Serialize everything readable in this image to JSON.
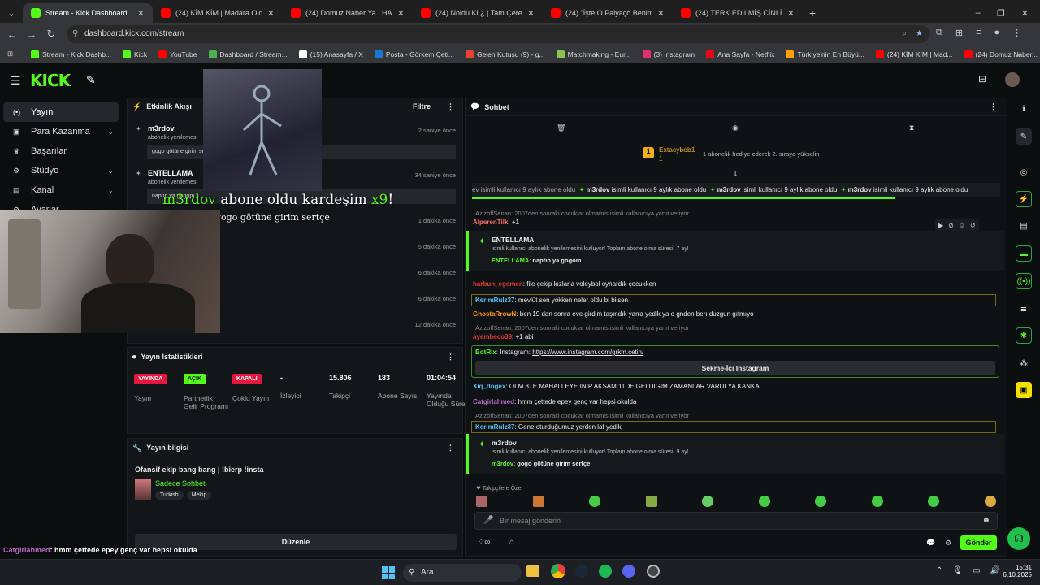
{
  "tabs": [
    {
      "title": "Stream - Kick Dashboard",
      "color": "#53fc18",
      "active": true
    },
    {
      "title": "(24) KİM KİM | Madara Olduk #",
      "color": "#ff0000"
    },
    {
      "title": "(24) Domuz Naber Ya | HAFTAL",
      "color": "#ff0000"
    },
    {
      "title": "(24) Noldu Ki ¿ | Tam Çerezlik | -",
      "color": "#ff0000"
    },
    {
      "title": "(24) \"İşte O Palyaço Benim\" Kic",
      "color": "#ff0000"
    },
    {
      "title": "(24) TERK EDİLMİŞ CİNLİ KÖYDE",
      "color": "#ff0000"
    }
  ],
  "url": "dashboard.kick.com/stream",
  "bookmarks": [
    "Stream - Kick Dashb...",
    "Kick",
    "YouTube",
    "Dashboard / Stream...",
    "(15) Anasayfa / X",
    "Posta - Görkem Çeti...",
    "Gelen Kutusu (9) - g...",
    "Matchmaking - Eur...",
    "(3) Instagram",
    "Ana Sayfa - Netflix",
    "Türkiye'nin En Büyü...",
    "(24) KİM KİM | Mad...",
    "(24) Domuz Naber..."
  ],
  "logo": "KICK",
  "sidebar": [
    {
      "label": "Yayın",
      "icon": "broadcast-icon",
      "active": true
    },
    {
      "label": "Para Kazanma",
      "icon": "money-icon",
      "chev": true
    },
    {
      "label": "Başarılar",
      "icon": "trophy-icon"
    },
    {
      "label": "Stüdyo",
      "icon": "gear-icon",
      "chev": true
    },
    {
      "label": "Kanal",
      "icon": "channel-icon",
      "chev": true
    },
    {
      "label": "Ayarlar",
      "icon": "settings-icon"
    }
  ],
  "activity": {
    "title": "Etkinlik Akışı",
    "filter": "Filtre",
    "events": [
      {
        "name": "m3rdov",
        "sub": "abonelik yenilemesi",
        "time": "2 saniye önce",
        "msg": "gogo götüne girim sertçe"
      },
      {
        "name": "ENTELLAMA",
        "sub": "abonelik yenilemesi",
        "time": "34 saniye önce",
        "msg": "naptın ya gogom"
      },
      {
        "time": "1 dakika önce"
      },
      {
        "time": "5 dakika önce"
      },
      {
        "time": "6 dakika önce"
      },
      {
        "time": "6 dakika önce"
      },
      {
        "time": "12 dakika önce"
      }
    ]
  },
  "overlay": {
    "name": "m3rdov",
    "text": "abone oldu kardeşim",
    "mult": "x9",
    "bang": "!",
    "msg": "gogo götüne girim sertçe"
  },
  "stats": {
    "title": "Yayın İstatistikleri",
    "items": [
      {
        "badge": "YAYINDA",
        "color": "#e5173f",
        "label": "Yayın"
      },
      {
        "badge": "AÇIK",
        "color": "#53fc18",
        "label": "Partnerlik Gelir Programı"
      },
      {
        "badge": "KAPALI",
        "color": "#e5173f",
        "label": "Çoklu Yayın"
      },
      {
        "value": "-",
        "label": "İzleyici"
      },
      {
        "value": "15.806",
        "label": "Takipçi"
      },
      {
        "value": "183",
        "label": "Abone Sayısı"
      },
      {
        "value": "01:04:54",
        "label": "Yayında Olduğu Süre"
      }
    ]
  },
  "info": {
    "title": "Yayın bilgisi",
    "stream_title": "Ofansif ekip bang bang | !bierp !insta",
    "category": "Sadece Sohbet",
    "tags": [
      "Turkish",
      "Mekip"
    ],
    "edit": "Düzenle"
  },
  "chat": {
    "title": "Sohbet",
    "top_user": "Extacybob1",
    "top_rank": "1",
    "top_note": "1 abonelik hediye ederek 2. sıraya yükselin",
    "ticker": "isimli kullanıcı 9 aylık abone oldu",
    "ticker_user": "m3rdov",
    "lines": [
      {
        "type": "reply",
        "text": "AzizoffSenan: 2007den sonraki cocuklar olmamis isimli kullanıcıya yanıt veriyor"
      },
      {
        "type": "msg",
        "user": "AlperenTilk",
        "ucolor": "#ff6b6b",
        "text": ": +1"
      },
      {
        "type": "sub",
        "user": "ENTELLAMA",
        "text": "isimli kullanıcı abonelik yenilemesini kutluyor! Toplam abone olma süresi: 7 ay!",
        "inner_user": "ENTELLAMA",
        "inner": "naptın ya gogom"
      },
      {
        "type": "msg",
        "user": "harbun_egemen",
        "ucolor": "#e53935",
        "text": ": file çekip kızlarla voleybol oynardık çocukken"
      },
      {
        "type": "msg",
        "user": "KerimRulz37",
        "ucolor": "#4fc3f7",
        "text": ": mevlüt sen yokken neler oldu bi bilsen"
      },
      {
        "type": "msg",
        "user": "GhostaRrowN",
        "ucolor": "#ff9800",
        "text": ": ben 19 dan sonra eve girdim taşındık yarra yedik ya o gnden berı duzgun gıtmıyo"
      },
      {
        "type": "reply",
        "text": "AzizoffSenan: 2007den sonraki cocuklar olmamis isimli kullanıcıya yanıt veriyor"
      },
      {
        "type": "msg",
        "user": "ayembeco39",
        "ucolor": "#e53935",
        "text": ": +1 abi"
      },
      {
        "type": "bot",
        "user": "BotRix",
        "text": ": İnstagram:",
        "link": "https://www.instagram.com/grkm.cetin/",
        "btn": "Sekme-İçi Instagram"
      },
      {
        "type": "msg",
        "user": "Xiq_dogex",
        "ucolor": "#4fc3f7",
        "text": ": OLM 3TE MAHALLEYE INIP AKSAM 11DE GELDIGIM ZAMANLAR VARDI YA KANKA"
      },
      {
        "type": "msg",
        "user": "Catgirlahmed",
        "ucolor": "#ba68c8",
        "text": ": hmm çettede epey genç var hepsi okulda"
      },
      {
        "type": "reply",
        "text": "AzizoffSenan: 2007den sonraki cocuklar olmamis isimli kullanıcıya yanıt veriyor"
      },
      {
        "type": "msg",
        "user": "KerimRulz37",
        "ucolor": "#4fc3f7",
        "text": ": Gene oturduğumuz yerden laf yedik"
      },
      {
        "type": "sub",
        "user": "m3rdov",
        "text": "isimli kullanıcı abonelik yenilemesini kutluyor! Toplam abone olma süresi: 9 ay!",
        "inner_user": "m3rdov",
        "inner": "gogo götüne girim sertçe"
      }
    ],
    "followers_label": "Takipçilere Özel",
    "placeholder": "Bir mesaj gönderin",
    "send": "Gönder"
  },
  "bottom_chat": [
    {
      "user": "Catgirlahmed",
      "color": "#ba68c8",
      "text": ": hmm çettede epey genç var hepsi okulda"
    },
    {
      "user": "KerimRulz37",
      "color": "#4fc3f7",
      "text": ": Gene oturduğumuz yerden laf yedik"
    },
    {
      "user": "m3rdov",
      "color": "#53fc18",
      "text": ": gogo götüne girim sertçe"
    }
  ],
  "taskbar": {
    "search": "Ara",
    "time": "15:31",
    "date": "6.10.2025"
  }
}
